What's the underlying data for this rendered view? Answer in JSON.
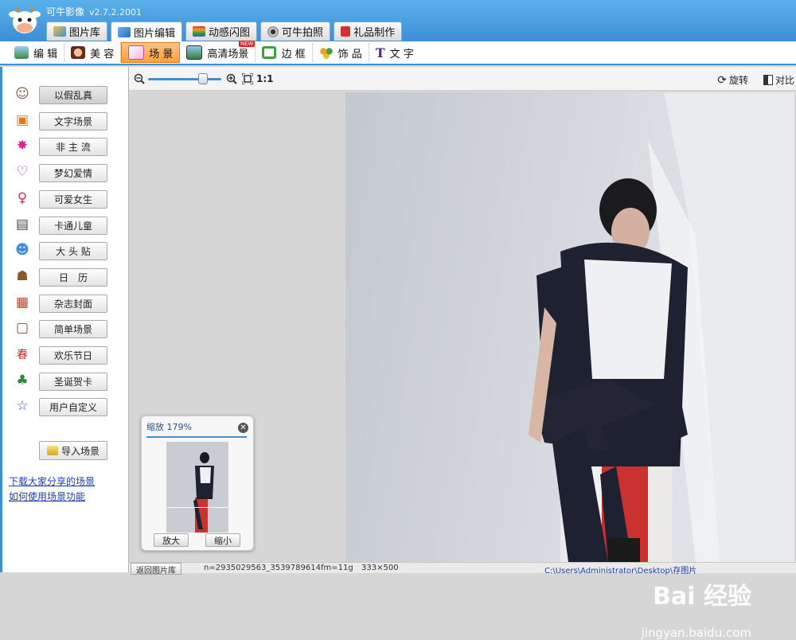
{
  "app": {
    "title": "可牛影像",
    "version": "v2.7.2.2001"
  },
  "main_tabs": [
    {
      "label": "图片库",
      "icon": "gallery-icon",
      "active": false
    },
    {
      "label": "图片编辑",
      "icon": "edit-image-icon",
      "active": true
    },
    {
      "label": "动感闪图",
      "icon": "animation-icon",
      "active": false
    },
    {
      "label": "可牛拍照",
      "icon": "webcam-icon",
      "active": false
    },
    {
      "label": "礼品制作",
      "icon": "gift-icon",
      "active": false
    }
  ],
  "sub_toolbar": [
    {
      "label": "编 辑",
      "icon": "edit-icon",
      "active": false
    },
    {
      "label": "美 容",
      "icon": "beauty-icon",
      "active": false
    },
    {
      "label": "场 景",
      "icon": "scene-icon",
      "active": true
    },
    {
      "label": "高清场景",
      "icon": "hd-scene-icon",
      "active": false,
      "badge": "NEW"
    },
    {
      "label": "边 框",
      "icon": "frame-icon",
      "active": false
    },
    {
      "label": "饰 品",
      "icon": "accessory-icon",
      "active": false
    },
    {
      "label": "文 字",
      "icon": "text-icon",
      "active": false
    }
  ],
  "scenes": [
    {
      "label": "以假乱真",
      "icon": "face-icon",
      "active": true
    },
    {
      "label": "文字场景",
      "icon": "text-scene-icon"
    },
    {
      "label": "非 主 流",
      "icon": "splash-icon"
    },
    {
      "label": "梦幻爱情",
      "icon": "heart-icon"
    },
    {
      "label": "可爱女生",
      "icon": "female-icon"
    },
    {
      "label": "卡通儿童",
      "icon": "book-icon"
    },
    {
      "label": "大 头 贴",
      "icon": "avatar-sticker-icon"
    },
    {
      "label": "日　历",
      "icon": "calendar-dog-icon"
    },
    {
      "label": "杂志封面",
      "icon": "calendar-icon"
    },
    {
      "label": "简单场景",
      "icon": "simple-frame-icon"
    },
    {
      "label": "欢乐节日",
      "icon": "festival-icon"
    },
    {
      "label": "圣诞贺卡",
      "icon": "christmas-tree-icon"
    },
    {
      "label": "用户自定义",
      "icon": "star-icon"
    }
  ],
  "import_button": "导入场景",
  "links": [
    "下载大家分享的场景",
    "如何使用场景功能"
  ],
  "zoom_toolbar": {
    "one_to_one": "1:1",
    "rotate": "旋转",
    "compare": "对比",
    "slider_value": 0.75
  },
  "navigator": {
    "title": "缩放 179%",
    "zoom_in": "放大",
    "zoom_out": "缩小"
  },
  "status": {
    "back": "返回图片库",
    "info": "n=2935029563_3539789614fm=11g",
    "size": "333×500",
    "path": "C:\\Users\\Administrator\\Desktop\\存图片"
  },
  "watermark": {
    "brand": "Bai 经验",
    "url": "jingyan.baidu.com"
  },
  "colors": {
    "title_bar": "#3d8fd6",
    "active_sub": "#ff9f3c",
    "link": "#1a3fb0"
  }
}
